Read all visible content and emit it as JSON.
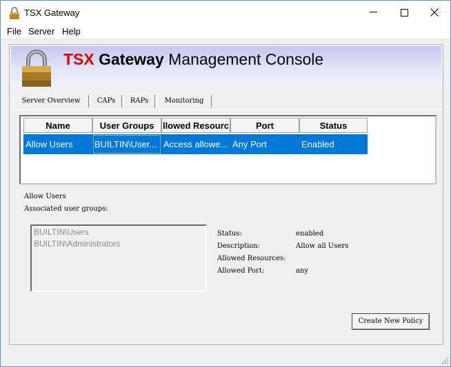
{
  "window": {
    "title": "TSX Gateway",
    "minimize_glyph": "—",
    "maximize_glyph": "☐",
    "close_glyph": "✕"
  },
  "menu": [
    "File",
    "Server",
    "Help"
  ],
  "banner": {
    "brand_red": "TSX",
    "brand_bold": "Gateway",
    "brand_rest": "Management Console",
    "accent_color": "#e00000"
  },
  "tabs": [
    {
      "label": "Server Overview",
      "active": false
    },
    {
      "label": "CAPs",
      "active": false
    },
    {
      "label": "RAPs",
      "active": true
    },
    {
      "label": "Monitoring",
      "active": false
    }
  ],
  "grid": {
    "columns": [
      "Name",
      "User Groups",
      "llowed Resourc",
      "Port",
      "Status"
    ],
    "rows": [
      {
        "name": "Allow Users",
        "user_groups": "BUILTIN\\User...",
        "allowed_resources": "Access allowe...",
        "port": "Any Port",
        "status": "Enabled"
      }
    ],
    "selection_color": "#0078d7"
  },
  "details": {
    "policy_name": "Allow Users",
    "groups_label": "Associated user groups:",
    "groups": [
      "BUILTIN\\Users",
      "BUILTIN\\Administrators"
    ],
    "fields": [
      {
        "label": "Status:",
        "value": "enabled"
      },
      {
        "label": "Description:",
        "value": "Allow all Users"
      },
      {
        "label": "Allowed Resources:",
        "value": ""
      },
      {
        "label": "Allowed Port:",
        "value": "any"
      }
    ]
  },
  "buttons": {
    "create_policy": "Create New Policy"
  }
}
